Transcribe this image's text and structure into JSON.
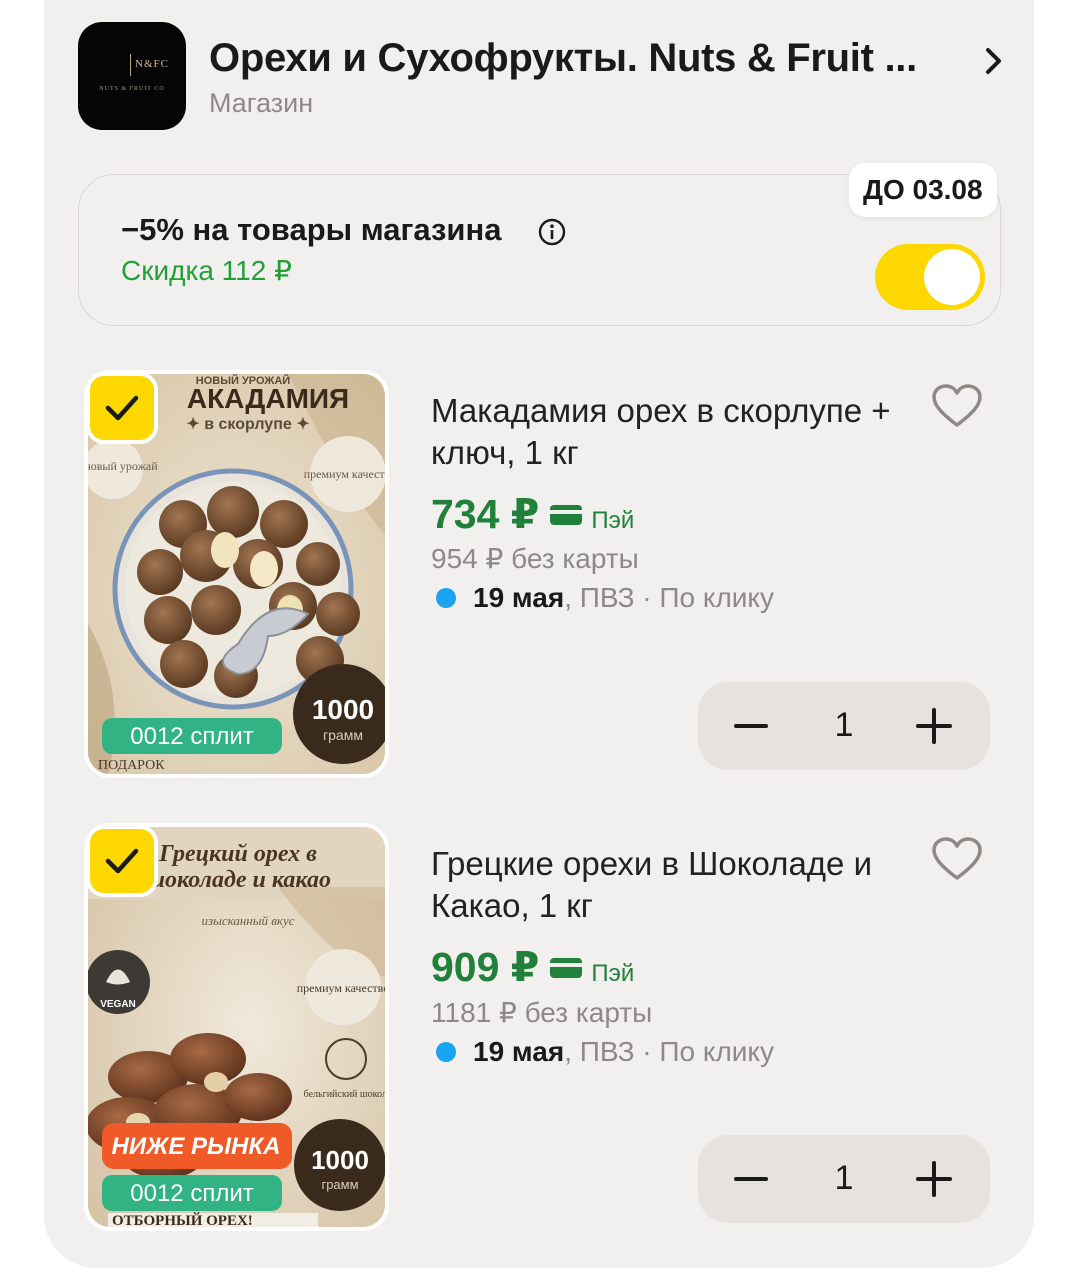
{
  "shop": {
    "logo_text": "N&FC",
    "logo_sub": "NUTS & FRUIT CO",
    "title": "Орехи и Сухофрукты. Nuts & Fruit ...",
    "subtitle": "Магазин"
  },
  "promo": {
    "badge": "ДО 03.08",
    "title": "−5% на товары магазина",
    "discount": "Скидка 112 ₽",
    "enabled": true,
    "accent_color": "#fcd800"
  },
  "products": [
    {
      "title": "Макадамия орех в скорлупе + ключ, 1 кг",
      "price": "734 ₽",
      "pay_label": "Пэй",
      "old_price": "954 ₽  без карты",
      "delivery_date": "19 мая",
      "delivery_rest": ", ПВЗ · По клику",
      "quantity": "1",
      "selected": true,
      "image": {
        "top_label": "НОВЫЙ УРОЖАЙ",
        "headline": "АКАДАМИЯ",
        "subline": "✦ в скорлупе ✦",
        "left_badge": "новый урожай",
        "right_badge": "премиум качество",
        "split_badge": "0012 сплит",
        "weight": "1000",
        "weight_unit": "грамм",
        "bottom": "ПОДАРОК"
      }
    },
    {
      "title": "Грецкие орехи в Шоколаде и Какао, 1 кг",
      "price": "909 ₽",
      "pay_label": "Пэй",
      "old_price": "1181 ₽  без карты",
      "delivery_date": "19 мая",
      "delivery_rest": ", ПВЗ · По клику",
      "quantity": "1",
      "selected": true,
      "image": {
        "headline": "Грецкий орех в",
        "subline": "шоколаде и какао",
        "tagline": "изысканный вкус",
        "vegan": "VEGAN",
        "right_badge": "премиум качество",
        "choc_badge": "бельгийский шоколад",
        "market_badge": "НИЖЕ РЫНКА",
        "split_badge": "0012 сплит",
        "weight": "1000",
        "weight_unit": "грамм",
        "bottom": "ОТБОРНЫЙ ОРЕХ!"
      }
    }
  ],
  "colors": {
    "price_green": "#21803a",
    "discount_green": "#21a038",
    "dot_blue": "#1aa3f0"
  }
}
